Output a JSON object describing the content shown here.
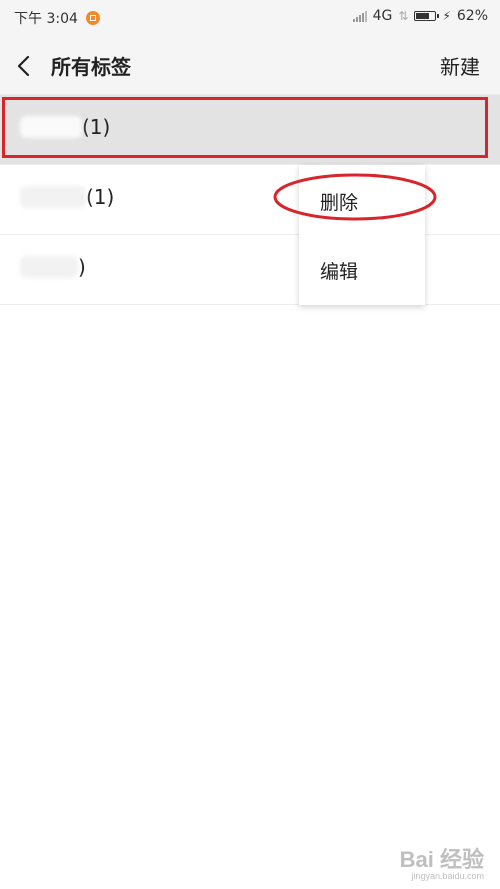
{
  "status_bar": {
    "time": "下午 3:04",
    "network": "4G",
    "battery": "62%",
    "battery_level": 0.62
  },
  "header": {
    "title": "所有标签",
    "new_label": "新建"
  },
  "tags": [
    {
      "suffix": "(1)"
    },
    {
      "suffix": "(1)"
    },
    {
      "suffix": ")"
    }
  ],
  "context_menu": {
    "delete_label": "删除",
    "edit_label": "编辑"
  },
  "watermark": {
    "main": "Bai 经验",
    "sub": "jingyan.baidu.com"
  },
  "colors": {
    "annotation": "#d7252c",
    "header_bg": "#f5f5f5",
    "selected_row_bg": "#e3e3e3"
  }
}
